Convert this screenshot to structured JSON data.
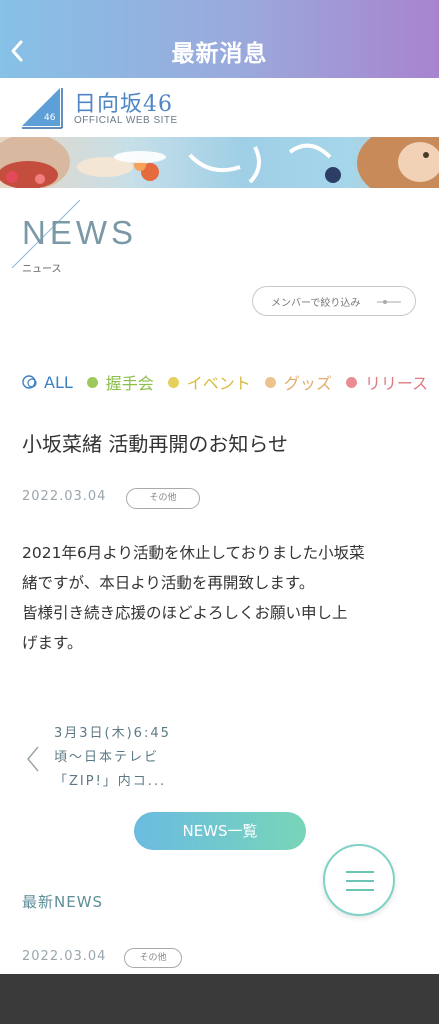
{
  "header": {
    "title": "最新消息"
  },
  "logo": {
    "name": "日向坂46",
    "subtitle": "OFFICIAL WEB SITE",
    "mark_number": "46"
  },
  "section": {
    "heading": "NEWS",
    "subheading": "ニュース"
  },
  "member_filter": {
    "label": "メンバーで絞り込み"
  },
  "categories": [
    {
      "label": "ALL",
      "color": "#3d7fc5",
      "text_color": "#3d7fc5"
    },
    {
      "label": "握手会",
      "color": "#9dc85a",
      "text_color": "#8cbf4a"
    },
    {
      "label": "イベント",
      "color": "#e6cf5a",
      "text_color": "#d9bb3f"
    },
    {
      "label": "グッズ",
      "color": "#ecc38a",
      "text_color": "#e3ad6e"
    },
    {
      "label": "リリース",
      "color": "#e98d93",
      "text_color": "#e07882"
    }
  ],
  "article": {
    "title": "小坂菜緒 活動再開のお知らせ",
    "date": "2022.03.04",
    "tag": "その他",
    "body_lines": [
      "2021年6月より活動を休止しておりました小坂菜",
      "緒ですが、本日より活動を再開致します。",
      "皆様引き続き応援のほどよろしくお願い申し上",
      "げます。"
    ]
  },
  "prev_article": {
    "lines": [
      "3月3日(木)6:45",
      "頃～日本テレビ",
      "「ZIP!」内コ..."
    ]
  },
  "list_button": {
    "label": "NEWS一覧"
  },
  "latest": {
    "heading": "最新NEWS",
    "date": "2022.03.04",
    "tag": "その他"
  }
}
